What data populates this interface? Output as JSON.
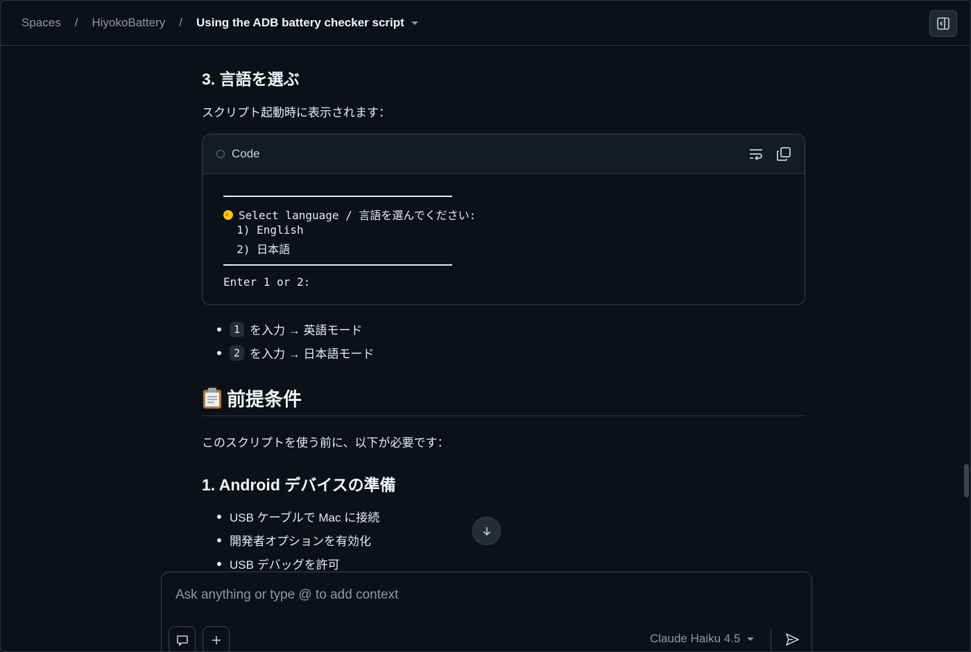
{
  "breadcrumb": {
    "items": [
      "Spaces",
      "HiyokoBattery"
    ],
    "separator": "/",
    "current": "Using the ADB battery checker script"
  },
  "section_language": {
    "heading": "3. 言語を選ぶ",
    "intro": "スクリプト起動時に表示されます：",
    "code": {
      "title": "Code",
      "lines": [
        "Select language / 言語を選んでください:",
        "  1) English",
        "  2) 日本語",
        "Enter 1 or 2:"
      ]
    },
    "options": [
      {
        "key": "1",
        "text": "を入力 → 英語モード"
      },
      {
        "key": "2",
        "text": "を入力 → 日本語モード"
      }
    ]
  },
  "section_prereq": {
    "heading": "前提条件",
    "icon": "clipboard-icon",
    "intro": "このスクリプトを使う前に、以下が必要です：",
    "sub_heading": "1. Android デバイスの準備",
    "items": [
      "USB ケーブルで Mac に接続",
      "開発者オプションを有効化",
      "USB デバッグを許可"
    ]
  },
  "composer": {
    "placeholder": "Ask anything or type @ to add context",
    "model": "Claude Haiku 4.5"
  },
  "colors": {
    "background": "#0d1117",
    "border": "#30363d",
    "text": "#e6edf3",
    "muted": "#9198a1"
  }
}
